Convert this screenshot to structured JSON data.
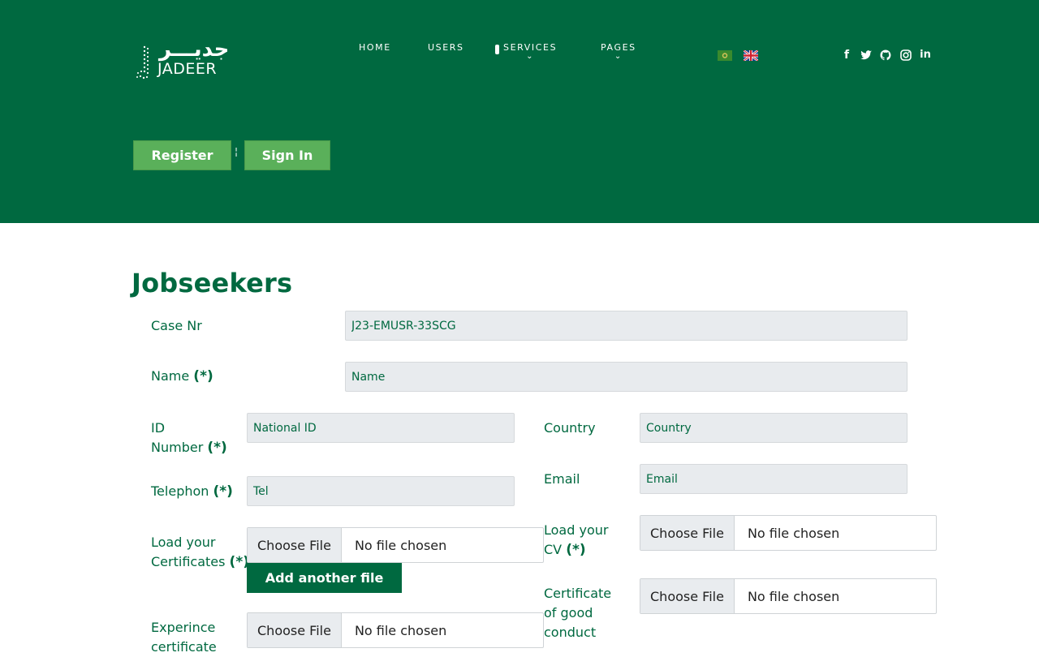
{
  "header": {
    "logo_arabic": "جديـــر",
    "logo_latin": "JADEER",
    "nav": [
      {
        "label": "HOME"
      },
      {
        "label": "USERS"
      },
      {
        "label": "SERVICES",
        "chevron": "⌄"
      },
      {
        "label": "PAGES",
        "chevron": "⌄"
      }
    ],
    "flags": [
      "arabic-flag-icon",
      "uk-flag-icon"
    ],
    "social": [
      {
        "icon": "facebook-icon",
        "glyph": "f"
      },
      {
        "icon": "twitter-icon",
        "glyph": "t"
      },
      {
        "icon": "github-icon",
        "glyph": "g"
      },
      {
        "icon": "instagram-icon",
        "glyph": "◎"
      },
      {
        "icon": "linkedin-icon",
        "glyph": "in"
      }
    ]
  },
  "auth": {
    "register": "Register",
    "separator": "¦",
    "signin": "Sign In"
  },
  "page_title": "Jobseekers",
  "required_marker": "(*)",
  "form": {
    "case_nr": {
      "label": "Case Nr",
      "value": "J23-EMUSR-33SCG"
    },
    "name": {
      "label": "Name",
      "placeholder": "Name"
    },
    "id_number": {
      "label_line1": "ID",
      "label_line2": "Number",
      "placeholder": "National ID"
    },
    "country": {
      "label": "Country",
      "placeholder": "Country"
    },
    "telephone": {
      "label": "Telephon",
      "placeholder": "Tel"
    },
    "email": {
      "label": "Email",
      "placeholder": "Email"
    },
    "certificates": {
      "label_line1": "Load your",
      "label_line2": "Certificates",
      "choose": "Choose File",
      "chosen": "No file chosen"
    },
    "cv": {
      "label_line1": "Load your",
      "label_line2": "CV",
      "choose": "Choose File",
      "chosen": "No file chosen"
    },
    "add_file_button": "Add another file",
    "good_conduct": {
      "label_line1": "Certificate",
      "label_line2": "of good",
      "label_line3": "conduct",
      "choose": "Choose File",
      "chosen": "No file chosen"
    },
    "experience": {
      "label_line1": "Experince",
      "label_line2": "certificate",
      "choose": "Choose File",
      "chosen": "No file chosen"
    }
  },
  "colors": {
    "primary": "#006940",
    "button_light": "#5ab05a",
    "input_bg": "#e8ebee"
  }
}
